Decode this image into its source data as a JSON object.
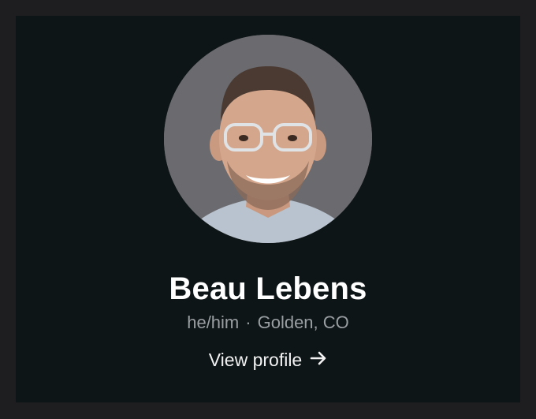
{
  "profile": {
    "name": "Beau Lebens",
    "pronouns": "he/him",
    "separator": "·",
    "location": "Golden, CO",
    "view_profile_label": "View profile",
    "avatar_icon": "profile-photo",
    "arrow_icon": "arrow-right-icon"
  },
  "colors": {
    "page_background": "#1e1e20",
    "card_background": "#0e1517",
    "name_text": "#ffffff",
    "meta_text": "#9a9fa3",
    "link_text": "#f2f2f2",
    "avatar_background": "#6b6b6f"
  }
}
